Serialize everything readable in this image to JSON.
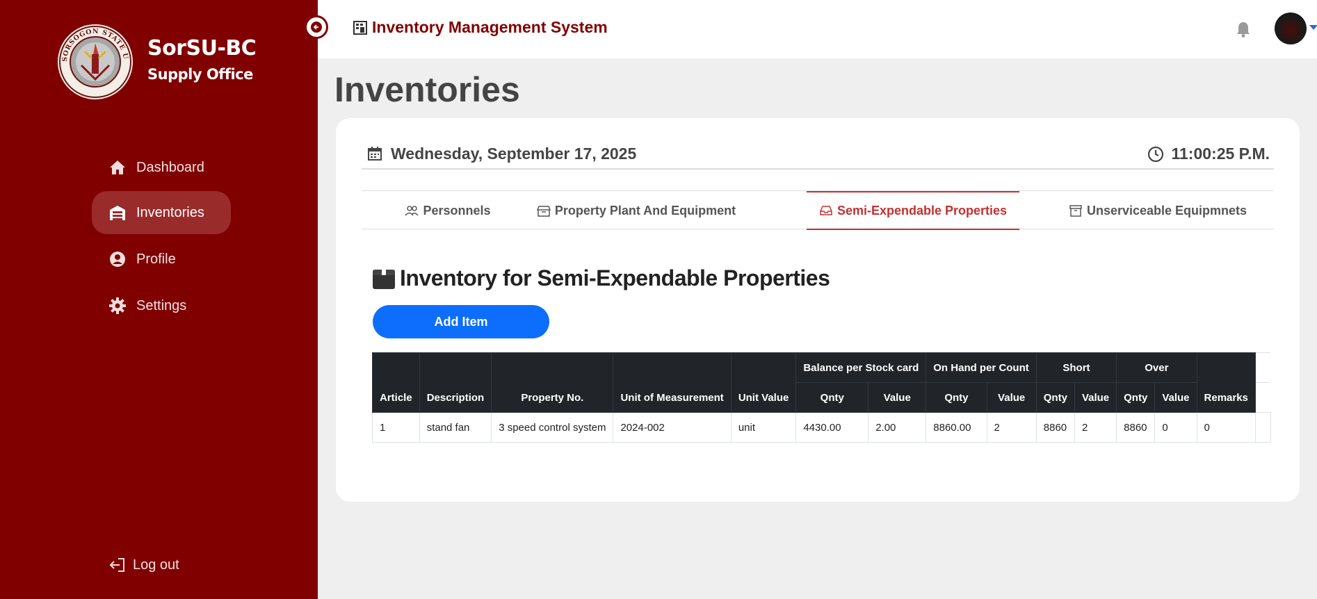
{
  "sidebar": {
    "brand_title": "SorSU-BC",
    "brand_subtitle": "Supply Office",
    "logo_text": "SORSOGON STATE UNIVERSITY",
    "items": [
      {
        "label": "Dashboard",
        "icon": "house-icon",
        "active": false
      },
      {
        "label": "Inventories",
        "icon": "warehouse-icon",
        "active": true
      },
      {
        "label": "Profile",
        "icon": "user-circle-icon",
        "active": false
      },
      {
        "label": "Settings",
        "icon": "gear-icon",
        "active": false
      }
    ],
    "logout_label": "Log out"
  },
  "topbar": {
    "title": "Inventory Management System",
    "bell_icon": "bell-icon",
    "avatar_icon": "avatar"
  },
  "page": {
    "title": "Inventories"
  },
  "card": {
    "date": "Wednesday, September 17, 2025",
    "time": "11:00:25 P.M.",
    "tabs": [
      {
        "label": "Personnels",
        "icon": "people-icon",
        "active": false
      },
      {
        "label": "Property Plant And Equipment",
        "icon": "box-icon",
        "active": false
      },
      {
        "label": "Semi-Expendable Properties",
        "icon": "inbox-icon",
        "active": true
      },
      {
        "label": "Unserviceable Equipmnets",
        "icon": "archive-icon",
        "active": false
      }
    ],
    "section_title": "Inventory for Semi-Expendable Properties",
    "add_button": "Add Item"
  },
  "table": {
    "group_headers": {
      "balance": "Balance per Stock card",
      "on_hand": "On Hand per Count",
      "short": "Short",
      "over": "Over"
    },
    "headers": {
      "article": "Article",
      "description": "Description",
      "property_no": "Property No.",
      "unit_of_measurement": "Unit of Measurement",
      "unit_value": "Unit Value",
      "qnty": "Qnty",
      "value": "Value",
      "remarks": "Remarks"
    },
    "rows": [
      [
        "1",
        "stand fan",
        "3 speed control system",
        "2024-002",
        "unit",
        "4430.00",
        "2.00",
        "8860.00",
        "2",
        "8860",
        "2",
        "8860",
        "0",
        "0"
      ]
    ]
  },
  "colors": {
    "sidebar": "#800000",
    "primary": "#0d6efd",
    "active_tab": "#c53030",
    "table_header": "#212529"
  }
}
